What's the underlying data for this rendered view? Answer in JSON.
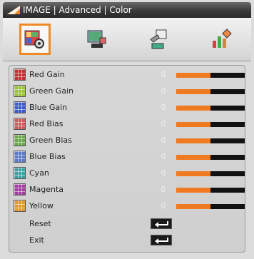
{
  "title": "IMAGE | Advanced | Color",
  "tabs": [
    {
      "icon": "image-settings-icon",
      "active": true
    },
    {
      "icon": "display-icon",
      "active": false
    },
    {
      "icon": "setup-icon",
      "active": false
    },
    {
      "icon": "options-icon",
      "active": false
    }
  ],
  "colors": {
    "accent": "#f07a22",
    "bar_bg": "#111111"
  },
  "items": [
    {
      "label": "Red Gain",
      "value": "0",
      "level": 0.5,
      "swatch": "#c03030"
    },
    {
      "label": "Green Gain",
      "value": "0",
      "level": 0.5,
      "swatch": "#9ac23a"
    },
    {
      "label": "Blue Gain",
      "value": "0",
      "level": 0.5,
      "swatch": "#3a5ac8"
    },
    {
      "label": "Red Bias",
      "value": "0",
      "level": 0.5,
      "swatch": "#c85a5a"
    },
    {
      "label": "Green Bias",
      "value": "0",
      "level": 0.5,
      "swatch": "#6aa84a"
    },
    {
      "label": "Blue Bias",
      "value": "0",
      "level": 0.5,
      "swatch": "#5a7ac8"
    },
    {
      "label": "Cyan",
      "value": "0",
      "level": 0.5,
      "swatch": "#3aa0a0"
    },
    {
      "label": "Magenta",
      "value": "0",
      "level": 0.5,
      "swatch": "#a03aa0"
    },
    {
      "label": "Yellow",
      "value": "0",
      "level": 0.5,
      "swatch": "#e09a2a"
    }
  ],
  "actions": [
    {
      "label": "Reset",
      "icon": "enter-icon"
    },
    {
      "label": "Exit",
      "icon": "enter-icon"
    }
  ]
}
